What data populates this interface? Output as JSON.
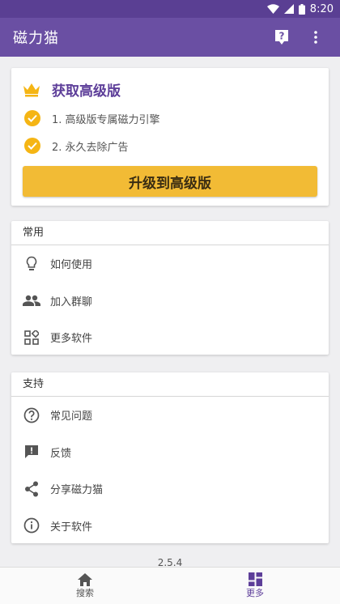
{
  "status_bar": {
    "time": "8:20"
  },
  "app_bar": {
    "title": "磁力猫"
  },
  "premium": {
    "heading": "获取高级版",
    "features": [
      "1. 高级版专属磁力引擎",
      "2. 永久去除广告"
    ],
    "upgrade_label": "升级到高级版"
  },
  "common": {
    "title": "常用",
    "items": [
      {
        "label": "如何使用",
        "icon": "lightbulb-icon"
      },
      {
        "label": "加入群聊",
        "icon": "people-icon"
      },
      {
        "label": "更多软件",
        "icon": "apps-icon"
      }
    ]
  },
  "support": {
    "title": "支持",
    "items": [
      {
        "label": "常见问题",
        "icon": "help-circle-icon"
      },
      {
        "label": "反馈",
        "icon": "feedback-icon"
      },
      {
        "label": "分享磁力猫",
        "icon": "share-icon"
      },
      {
        "label": "关于软件",
        "icon": "info-icon"
      }
    ]
  },
  "version": "2.5.4",
  "bottom_nav": {
    "tabs": [
      {
        "label": "搜索",
        "icon": "home-icon",
        "active": false
      },
      {
        "label": "更多",
        "icon": "dashboard-icon",
        "active": true
      }
    ]
  },
  "colors": {
    "primary": "#6a4fa3",
    "status": "#5a3f93",
    "accent": "#f5b514",
    "button": "#f2bb35"
  }
}
